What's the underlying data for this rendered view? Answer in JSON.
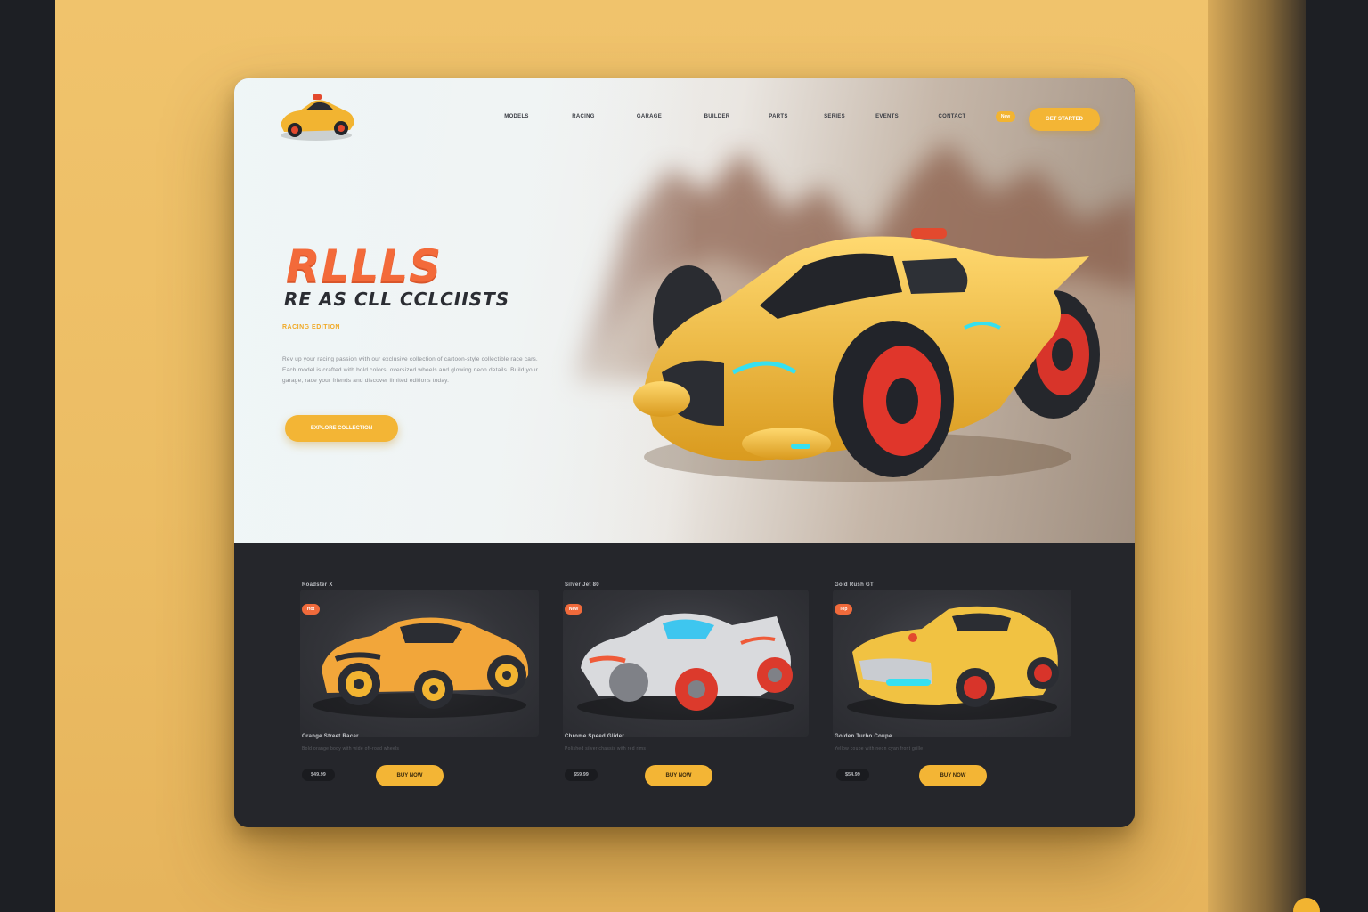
{
  "colors": {
    "accent": "#f3b535",
    "title": "#f36a3a",
    "dark_panel": "#25262b",
    "backdrop": "#ecbd64"
  },
  "brand": {
    "logo_icon": "yellow-toy-car-logo-icon"
  },
  "nav": {
    "items": [
      "Models",
      "Racing",
      "Garage",
      "Builder",
      "Parts",
      "Series",
      "Events",
      "Contact"
    ],
    "badge": "New",
    "cta": "Get Started"
  },
  "hero": {
    "title": "RLLLS",
    "subtitle": "RE AS CLL CCLCIISTS",
    "tagline": "Racing Edition",
    "body": "Rev up your racing passion with our exclusive collection of cartoon-style collectible race cars. Each model is crafted with bold colors, oversized wheels and glowing neon details. Build your garage, race your friends and discover limited editions today.",
    "cta": "Explore Collection"
  },
  "products": [
    {
      "label": "Roadster X",
      "badge": "Hot",
      "title": "Orange Street Racer",
      "desc": "Bold orange body with wide off-road wheels",
      "price": "$49.99",
      "button": "Buy Now"
    },
    {
      "label": "Silver Jet 80",
      "badge": "New",
      "title": "Chrome Speed Glider",
      "desc": "Polished silver chassis with red rims",
      "price": "$59.99",
      "button": "Buy Now"
    },
    {
      "label": "Gold Rush GT",
      "badge": "Top",
      "title": "Golden Turbo Coupe",
      "desc": "Yellow coupe with neon cyan front grille",
      "price": "$54.99",
      "button": "Buy Now"
    }
  ]
}
